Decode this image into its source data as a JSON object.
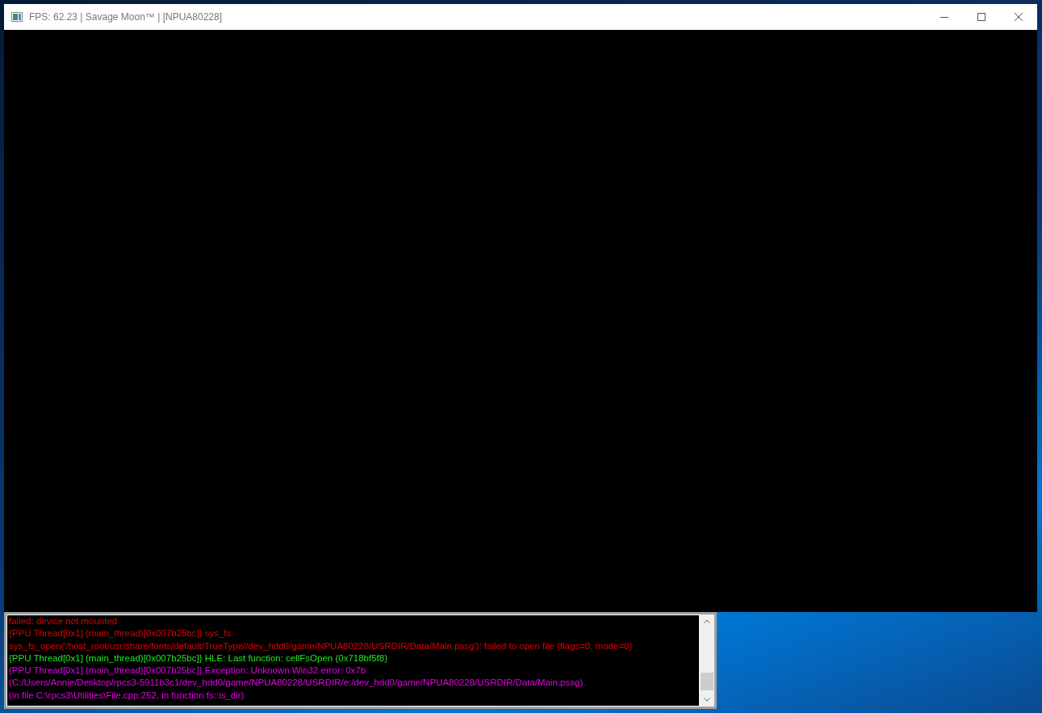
{
  "window": {
    "title": "FPS: 62.23 | Savage Moon™ | [NPUA80228]"
  },
  "log": {
    "lines": [
      {
        "text": "failed: device not mounted",
        "color": "#e00000"
      },
      {
        "text": "{PPU Thread[0x1] (main_thread)[0x007b25bc]} sys_fs:",
        "color": "#e00000"
      },
      {
        "text": "sys_fs_open('/host_root/usr/share/fonts/default/TrueType//dev_hdd0/game/NPUA80228/USRDIR/Data/Main.pssg'): failed to open file (flags=0, mode=0)",
        "color": "#e00000"
      },
      {
        "text": "{PPU Thread[0x1] (main_thread)[0x007b25bc]} HLE: Last function: cellFsOpen (0x718bf5f8)",
        "color": "#22e622"
      },
      {
        "text": "{PPU Thread[0x1] (main_thread)[0x007b25bc]} Exception: Unknown Win32 error: 0x7b",
        "color": "#e600e6"
      },
      {
        "text": "(C:/Users/Annie/Desktop/rpcs3-5911b3c1/dev_hdd0/game/NPUA80228/USRDIR/e:/dev_hdd0/game/NPUA80228/USRDIR/Data/Main.pssg).",
        "color": "#e600e6"
      },
      {
        "text": "(in file C:\\rpcs3\\Utilities\\File.cpp:252, in function fs::is_dir)",
        "color": "#e600e6"
      }
    ]
  }
}
